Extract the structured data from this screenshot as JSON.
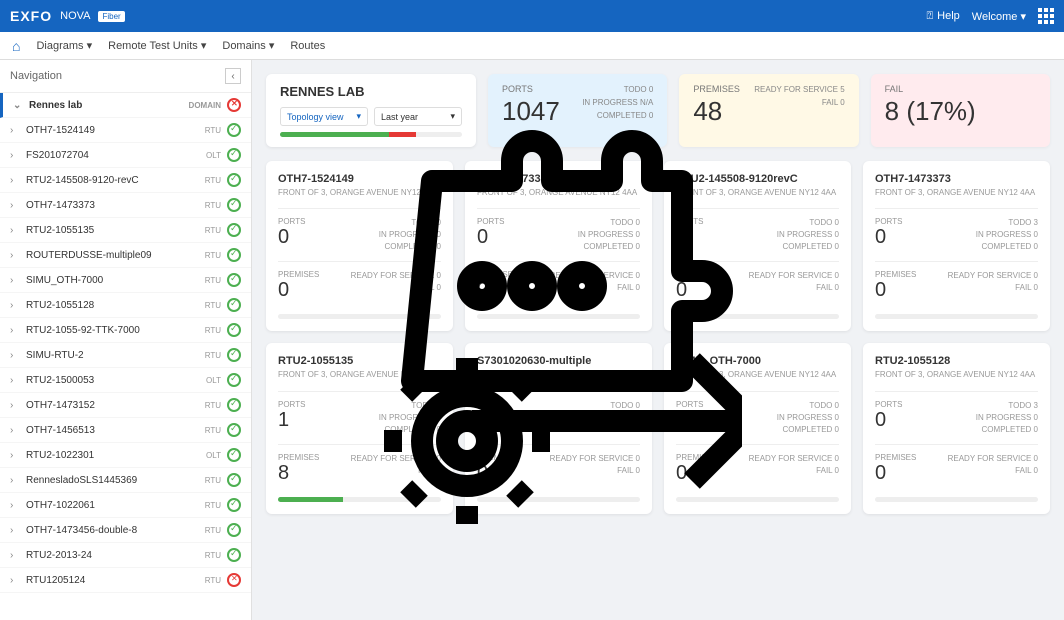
{
  "topbar": {
    "logo": "EXFO",
    "product": "NOVA",
    "badge": "Fiber",
    "help": "Help",
    "welcome": "Welcome ▾"
  },
  "menubar": {
    "items": [
      "Diagrams ▾",
      "Remote Test Units ▾",
      "Domains ▾",
      "Routes"
    ]
  },
  "sidebar": {
    "title": "Navigation",
    "root": {
      "label": "Rennes lab",
      "tag": "DOMAIN",
      "status": "err"
    },
    "items": [
      {
        "label": "OTH7-1524149",
        "tag": "RTU",
        "status": "ok"
      },
      {
        "label": "FS201072704",
        "tag": "OLT",
        "status": "ok"
      },
      {
        "label": "RTU2-145508-9120-revC",
        "tag": "RTU",
        "status": "ok"
      },
      {
        "label": "OTH7-1473373",
        "tag": "RTU",
        "status": "ok"
      },
      {
        "label": "RTU2-1055135",
        "tag": "RTU",
        "status": "ok"
      },
      {
        "label": "ROUTERDUSSE-multiple09",
        "tag": "RTU",
        "status": "ok"
      },
      {
        "label": "SIMU_OTH-7000",
        "tag": "RTU",
        "status": "ok"
      },
      {
        "label": "RTU2-1055128",
        "tag": "RTU",
        "status": "ok"
      },
      {
        "label": "RTU2-1055-92-TTK-7000",
        "tag": "RTU",
        "status": "ok"
      },
      {
        "label": "SIMU-RTU-2",
        "tag": "RTU",
        "status": "ok"
      },
      {
        "label": "RTU2-1500053",
        "tag": "OLT",
        "status": "ok"
      },
      {
        "label": "OTH7-1473152",
        "tag": "RTU",
        "status": "ok"
      },
      {
        "label": "OTH7-1456513",
        "tag": "RTU",
        "status": "ok"
      },
      {
        "label": "RTU2-1022301",
        "tag": "OLT",
        "status": "ok"
      },
      {
        "label": "RennesladoSLS1445369",
        "tag": "RTU",
        "status": "ok"
      },
      {
        "label": "OTH7-1022061",
        "tag": "RTU",
        "status": "ok"
      },
      {
        "label": "OTH7-1473456-double-8",
        "tag": "RTU",
        "status": "ok"
      },
      {
        "label": "RTU2-2013-24",
        "tag": "RTU",
        "status": "ok"
      },
      {
        "label": "RTU1205124",
        "tag": "RTU",
        "status": "err"
      }
    ]
  },
  "head_panel": {
    "title": "RENNES LAB",
    "select1": "Topology view",
    "select2": "Last year",
    "prog_a": 60,
    "prog_b": 15
  },
  "stats": [
    {
      "cls": "c-blue",
      "label": "PORTS",
      "value": "1047",
      "rows": [
        "TODO 0",
        "IN PROGRESS N/A",
        "COMPLETED 0"
      ]
    },
    {
      "cls": "c-yellow",
      "label": "PREMISES",
      "value": "48",
      "rows": [
        "READY FOR SERVICE 5",
        "FAIL 0"
      ]
    },
    {
      "cls": "c-pink",
      "label": "FAIL",
      "value": "8 (17%)",
      "rows": []
    }
  ],
  "cards": [
    {
      "title": "OTH7-1524149",
      "addr": "FRONT OF 3, ORANGE AVENUE NY12 4AA",
      "ports": "0",
      "prem": "0",
      "pr": [
        "TODO 0",
        "IN PROGRESS 0",
        "COMPLETED 0"
      ],
      "pr2": [
        "READY FOR SERVICE 0",
        "FAIL 0"
      ],
      "ga": 0,
      "gb": 0
    },
    {
      "title": "OTH7-1473373",
      "addr": "FRONT OF 3, ORANGE AVENUE NY12 4AA",
      "ports": "0",
      "prem": "0",
      "pr": [
        "TODO 0",
        "IN PROGRESS 0",
        "COMPLETED 0"
      ],
      "pr2": [
        "READY FOR SERVICE 0",
        "FAIL 0"
      ],
      "ga": 0,
      "gb": 0
    },
    {
      "title": "RTU2-145508-9120revC",
      "addr": "FRONT OF 3, ORANGE AVENUE NY12 4AA",
      "ports": "2",
      "prem": "0",
      "pr": [
        "TODO 0",
        "IN PROGRESS 0",
        "COMPLETED 0"
      ],
      "pr2": [
        "READY FOR SERVICE 0",
        "FAIL 0"
      ],
      "ga": 0,
      "gb": 0
    },
    {
      "title": "OTH7-1473373",
      "addr": "FRONT OF 3, ORANGE AVENUE NY12 4AA",
      "ports": "0",
      "prem": "0",
      "pr": [
        "TODO 3",
        "IN PROGRESS 0",
        "COMPLETED 0"
      ],
      "pr2": [
        "READY FOR SERVICE 0",
        "FAIL 0"
      ],
      "ga": 0,
      "gb": 0
    },
    {
      "title": "RTU2-1055135",
      "addr": "FRONT OF 3, ORANGE AVENUE NY12 4AA",
      "ports": "1",
      "prem": "8",
      "pr": [
        "TODO 0",
        "IN PROGRESS 0",
        "COMPLETED 0"
      ],
      "pr2": [
        "READY FOR SERVICE 0",
        "FAIL 0"
      ],
      "ga": 40,
      "gb": 0
    },
    {
      "title": "S7301020630-multiple",
      "addr": "FRONT OF 3, ORANGE AVENUE NY12 4AA",
      "ports": "0",
      "prem": "0",
      "pr": [
        "TODO 0",
        "IN PROGRESS 0",
        "COMPLETED 0"
      ],
      "pr2": [
        "READY FOR SERVICE 0",
        "FAIL 0"
      ],
      "ga": 0,
      "gb": 0
    },
    {
      "title": "SIMU_OTH-7000",
      "addr": "FRONT OF 3, ORANGE AVENUE NY12 4AA",
      "ports": "0",
      "prem": "0",
      "pr": [
        "TODO 0",
        "IN PROGRESS 0",
        "COMPLETED 0"
      ],
      "pr2": [
        "READY FOR SERVICE 0",
        "FAIL 0"
      ],
      "ga": 0,
      "gb": 0
    },
    {
      "title": "RTU2-1055128",
      "addr": "FRONT OF 3, ORANGE AVENUE NY12 4AA",
      "ports": "0",
      "prem": "0",
      "pr": [
        "TODO 3",
        "IN PROGRESS 0",
        "COMPLETED 0"
      ],
      "pr2": [
        "READY FOR SERVICE 0",
        "FAIL 0"
      ],
      "ga": 0,
      "gb": 0
    }
  ]
}
